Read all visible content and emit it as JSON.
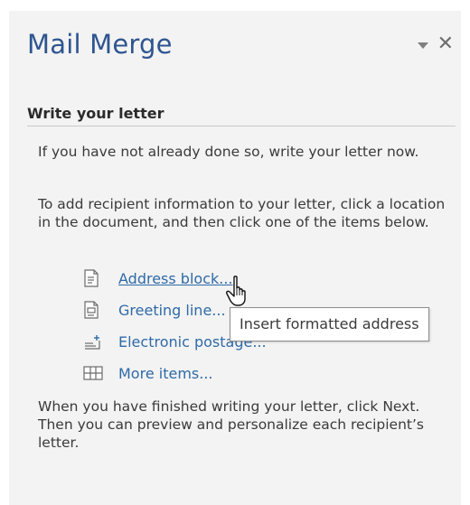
{
  "pane": {
    "title": "Mail Merge",
    "controls": {
      "dropdown_icon": "chevron-down-icon",
      "close_label": "✕"
    }
  },
  "section": {
    "heading": "Write your letter",
    "intro": "If you have not already done so, write your letter now.",
    "instructions": "To add recipient information to your letter, click a location in the document, and then click one of the items below.",
    "footer": "When you have finished writing your letter, click Next. Then you can preview and personalize each recipient’s letter."
  },
  "items": [
    {
      "label": "Address block...",
      "icon": "address-block-icon"
    },
    {
      "label": "Greeting line...",
      "icon": "greeting-line-icon"
    },
    {
      "label": "Electronic postage...",
      "icon": "electronic-postage-icon"
    },
    {
      "label": "More items...",
      "icon": "more-items-icon"
    }
  ],
  "tooltip": {
    "text": "Insert formatted address"
  },
  "colors": {
    "title": "#2e5590",
    "link": "#2f6aa7",
    "pane_background": "#f3f3f3"
  }
}
